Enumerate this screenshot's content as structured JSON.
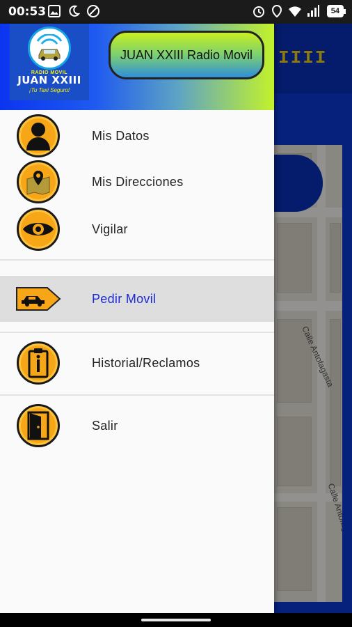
{
  "status_bar": {
    "time": "00:53",
    "battery": "54",
    "left_icons": [
      "image-icon",
      "moon-icon",
      "dnd-icon"
    ],
    "right_icons": [
      "alarm-icon",
      "location-icon",
      "wifi-icon",
      "signal-icon",
      "battery-icon"
    ]
  },
  "background_app": {
    "top_sign": "IIII",
    "map_streets": [
      "Calle Antofagasta",
      "Calle Antofagasta"
    ]
  },
  "drawer": {
    "logo": {
      "top_text": "RADIO MOVIL",
      "name": "JUAN XXIII",
      "tagline": "¡Tu Taxi Seguro!"
    },
    "header_title": "JUAN XXIII Radio Movil",
    "items": [
      {
        "label": "Mis Datos",
        "icon": "user-icon",
        "active": false
      },
      {
        "label": "Mis Direcciones",
        "icon": "map-pin-icon",
        "active": false
      },
      {
        "label": "Vigilar",
        "icon": "eye-icon",
        "active": false
      },
      {
        "label": "Pedir Movil",
        "icon": "taxi-icon",
        "active": true
      },
      {
        "label": "Historial/Reclamos",
        "icon": "clipboard-icon",
        "active": false
      },
      {
        "label": "Salir",
        "icon": "door-icon",
        "active": false
      }
    ]
  },
  "colors": {
    "accent_active": "#1a2ad6",
    "icon_orange": "#f7a617",
    "header_blue": "#0b34f0",
    "header_green": "#c3f22a"
  }
}
